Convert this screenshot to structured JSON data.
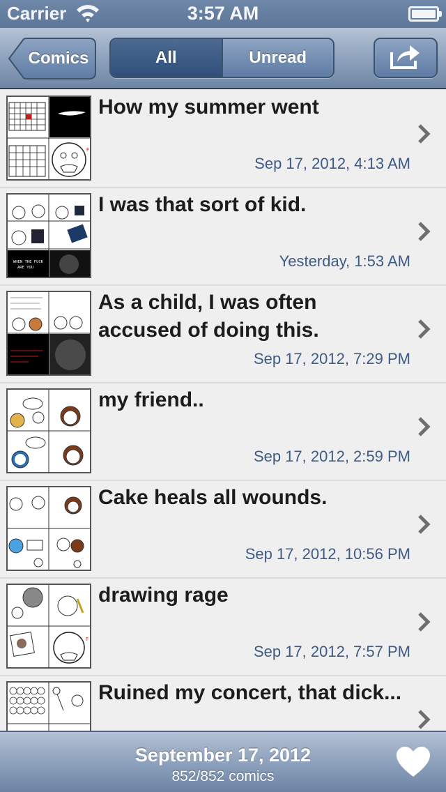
{
  "status_bar": {
    "carrier": "Carrier",
    "time": "3:57 AM",
    "wifi_icon": "wifi-icon",
    "battery_icon": "battery-icon"
  },
  "nav": {
    "back_label": "Comics",
    "segments": [
      {
        "label": "All",
        "selected": true
      },
      {
        "label": "Unread",
        "selected": false
      }
    ],
    "share_icon": "share-icon"
  },
  "comics": [
    {
      "title": "How my summer went",
      "date": "Sep 17, 2012, 4:13 AM",
      "thumb": "calendar"
    },
    {
      "title": "I was that sort of kid.",
      "date": "Yesterday, 1:53 AM",
      "thumb": "grid"
    },
    {
      "title": "As a child, I was often accused of doing this.",
      "date": "Sep 17, 2012, 7:29 PM",
      "thumb": "dark"
    },
    {
      "title": "my friend..",
      "date": "Sep 17, 2012, 2:59 PM",
      "thumb": "faces"
    },
    {
      "title": "Cake heals all wounds.",
      "date": "Sep 17, 2012, 10:56 PM",
      "thumb": "faces2"
    },
    {
      "title": "drawing rage",
      "date": "Sep 17, 2012, 7:57 PM",
      "thumb": "rage"
    },
    {
      "title": "Ruined my concert, that dick...",
      "date": "",
      "thumb": "crowd"
    }
  ],
  "toolbar": {
    "date": "September 17, 2012",
    "count": "852/852 comics",
    "favorite_icon": "heart-icon"
  },
  "colors": {
    "nav_gradient_top": "#b5c3d5",
    "nav_gradient_bottom": "#6e86a6",
    "date_text": "#3e5b86",
    "background": "#efefef"
  }
}
